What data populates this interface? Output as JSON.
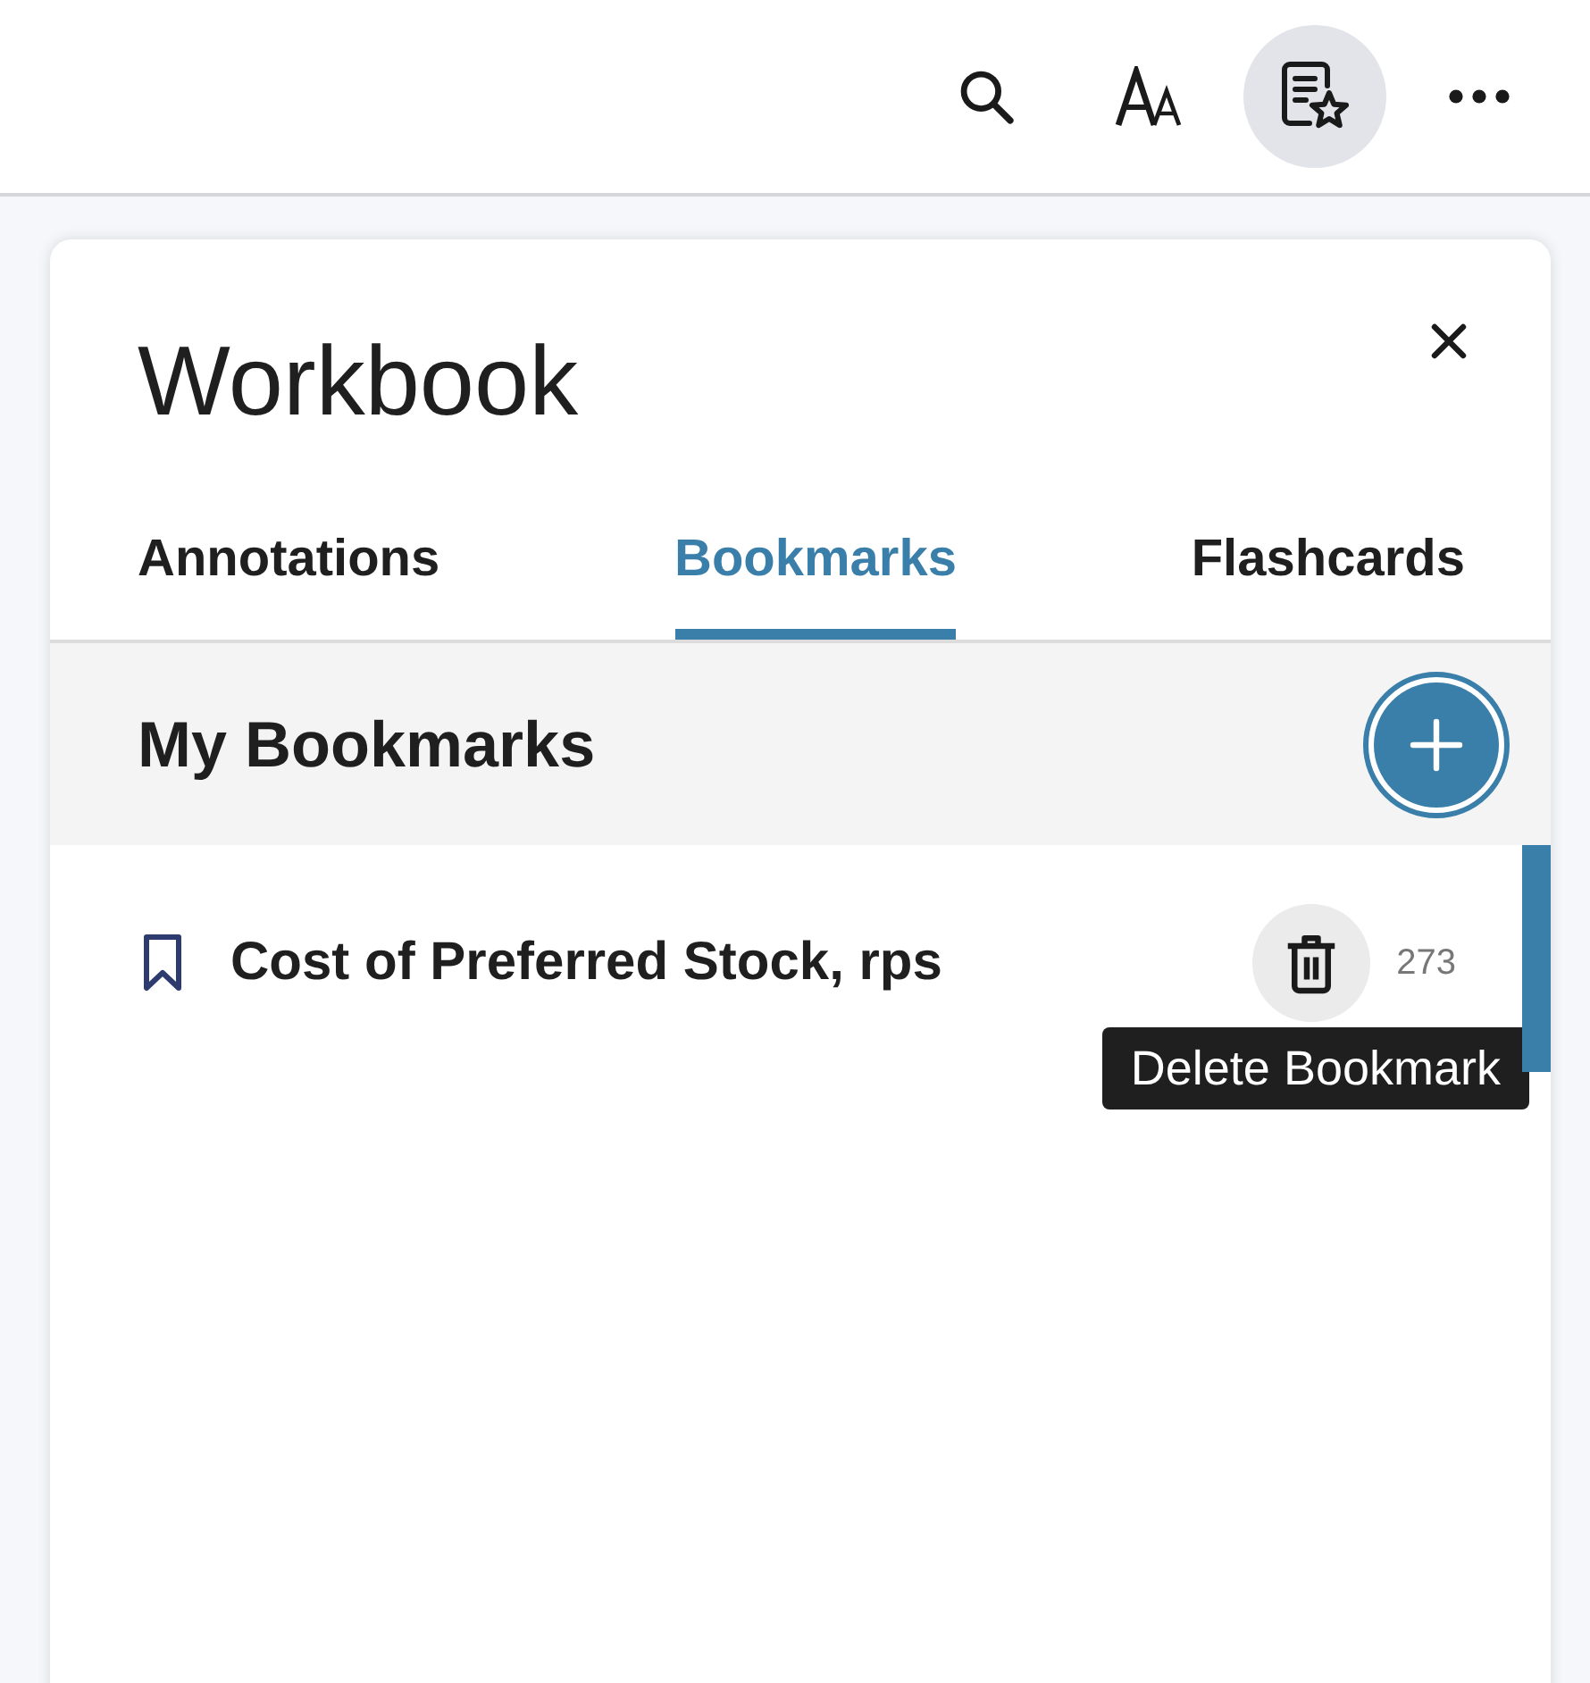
{
  "toolbar": {
    "buttons": [
      {
        "kind": "search",
        "selected": false
      },
      {
        "kind": "text_size",
        "selected": false
      },
      {
        "kind": "workbook",
        "selected": true
      },
      {
        "kind": "more",
        "selected": false
      }
    ]
  },
  "panel": {
    "title": "Workbook",
    "tabs": [
      {
        "label": "Annotations",
        "selected": false
      },
      {
        "label": "Bookmarks",
        "selected": true
      },
      {
        "label": "Flashcards",
        "selected": false
      }
    ],
    "section": {
      "title": "My Bookmarks"
    },
    "bookmarks": [
      {
        "title": "Cost of Preferred Stock, rps",
        "page": "273",
        "tooltip": "Delete Bookmark"
      }
    ]
  }
}
